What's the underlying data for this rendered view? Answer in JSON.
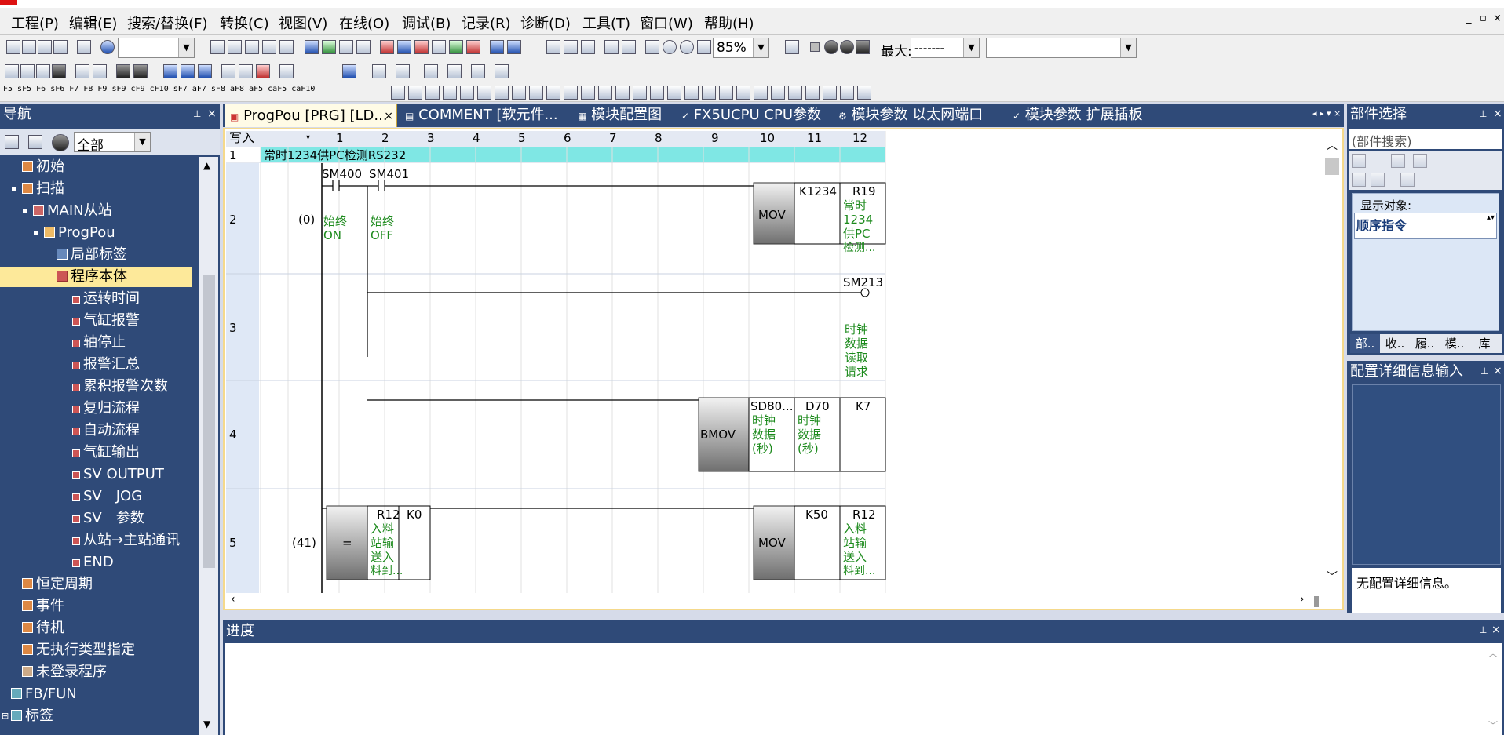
{
  "menu": [
    "工程(P)",
    "编辑(E)",
    "搜索/替换(F)",
    "转换(C)",
    "视图(V)",
    "在线(O)",
    "调试(B)",
    "记录(R)",
    "诊断(D)",
    "工具(T)",
    "窗口(W)",
    "帮助(H)"
  ],
  "window_controls": [
    "_",
    "▫",
    "×"
  ],
  "toolbar": {
    "zoom": "85%",
    "max_label": "最大:",
    "max_value": "-------",
    "fkeys_row": "F5 sF5 F6 sF6 F7 F8   F9 sF9 cF9 cF10 sF7 aF7 sF8 aF8 aF5 caF5 caF10"
  },
  "nav": {
    "title": "导航",
    "filter": "全部",
    "tree": [
      {
        "label": "初始",
        "level": 1
      },
      {
        "label": "扫描",
        "level": 1,
        "expanded": true
      },
      {
        "label": "MAIN从站",
        "level": 2,
        "expanded": true
      },
      {
        "label": "ProgPou",
        "level": 3,
        "expanded": true
      },
      {
        "label": "局部标签",
        "level": 4
      },
      {
        "label": "程序本体",
        "level": 4,
        "selected": true
      },
      {
        "label": "运转时间",
        "level": 5
      },
      {
        "label": "气缸报警",
        "level": 5
      },
      {
        "label": "轴停止",
        "level": 5
      },
      {
        "label": "报警汇总",
        "level": 5
      },
      {
        "label": "累积报警次数",
        "level": 5
      },
      {
        "label": "复归流程",
        "level": 5
      },
      {
        "label": "自动流程",
        "level": 5
      },
      {
        "label": "气缸输出",
        "level": 5
      },
      {
        "label": "SV OUTPUT",
        "level": 5
      },
      {
        "label": "SV　JOG",
        "level": 5
      },
      {
        "label": "SV　参数",
        "level": 5
      },
      {
        "label": "从站→主站通讯",
        "level": 5
      },
      {
        "label": "END",
        "level": 5
      },
      {
        "label": "恒定周期",
        "level": 1
      },
      {
        "label": "事件",
        "level": 1
      },
      {
        "label": "待机",
        "level": 1
      },
      {
        "label": "无执行类型指定",
        "level": 1
      },
      {
        "label": "未登录程序",
        "level": 1
      },
      {
        "label": "FB/FUN",
        "level": 0
      },
      {
        "label": "标签",
        "level": 0,
        "expanded": false
      }
    ]
  },
  "tabs": [
    {
      "label": "ProgPou [PRG] [LD...",
      "active": true
    },
    {
      "label": "COMMENT [软元件..."
    },
    {
      "label": "模块配置图"
    },
    {
      "label": "FX5UCPU CPU参数"
    },
    {
      "label": "模块参数 以太网端口"
    },
    {
      "label": "模块参数 扩展插板"
    }
  ],
  "ladder": {
    "mode_label": "写入",
    "columns": [
      "1",
      "2",
      "3",
      "4",
      "5",
      "6",
      "7",
      "8",
      "9",
      "10",
      "11",
      "12"
    ],
    "comment_row": {
      "num": "1",
      "text": "常时1234供PC检测RS232"
    },
    "rows": [
      {
        "num": "2",
        "step": "(0)"
      },
      {
        "num": "3",
        "step": ""
      },
      {
        "num": "4",
        "step": ""
      },
      {
        "num": "5",
        "step": "(41)"
      }
    ],
    "r2": {
      "c1_dev": "SM400",
      "c1_cmt": [
        "始终",
        "ON"
      ],
      "c2_dev": "SM401",
      "c2_cmt": [
        "始终",
        "OFF"
      ],
      "inst": "MOV",
      "op1": "K1234",
      "op2": "R19",
      "op2_cmt": [
        "常时",
        "1234",
        "供PC",
        "检测..."
      ]
    },
    "r3": {
      "coil": "SM213",
      "coil_cmt": [
        "时钟",
        "数据",
        "读取",
        "请求"
      ]
    },
    "r4": {
      "inst": "BMOV",
      "op1": "SD80...",
      "op1_cmt": [
        "时钟",
        "数据",
        "(秒)"
      ],
      "op2": "D70",
      "op2_cmt": [
        "时钟",
        "数据",
        "(秒)"
      ],
      "op3": "K7"
    },
    "r5": {
      "cmp": "=",
      "cmp_op1": "R12",
      "cmp_op1_cmt": [
        "入料",
        "站输",
        "送入",
        "料到..."
      ],
      "cmp_op2": "K0",
      "inst": "MOV",
      "op1": "K50",
      "op2": "R12",
      "op2_cmt": [
        "入料",
        "站输",
        "送入",
        "料到..."
      ]
    }
  },
  "parts": {
    "title": "部件选择",
    "search_placeholder": "(部件搜索)",
    "display_label": "显示对象:",
    "display_value": "顺序指令",
    "bottom_tabs": [
      "部..",
      "收..",
      "履..",
      "模..",
      "库"
    ]
  },
  "config": {
    "title": "配置详细信息输入",
    "empty_msg": "无配置详细信息。"
  },
  "progress": {
    "title": "进度"
  }
}
